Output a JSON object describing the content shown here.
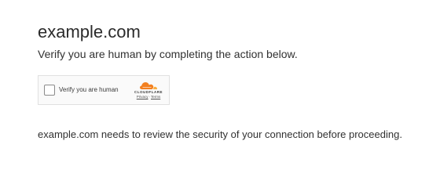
{
  "page": {
    "title": "example.com",
    "subtitle": "Verify you are human by completing the action below.",
    "footer": "example.com needs to review the security of your connection before proceeding."
  },
  "widget": {
    "checkbox_label": "Verify you are human",
    "checked": false,
    "brand": "CLOUDFLARE",
    "privacy_link": "Privacy",
    "separator": "·",
    "terms_link": "Terms",
    "brand_colors": {
      "orange": "#f38020",
      "light_orange": "#faae40"
    }
  }
}
